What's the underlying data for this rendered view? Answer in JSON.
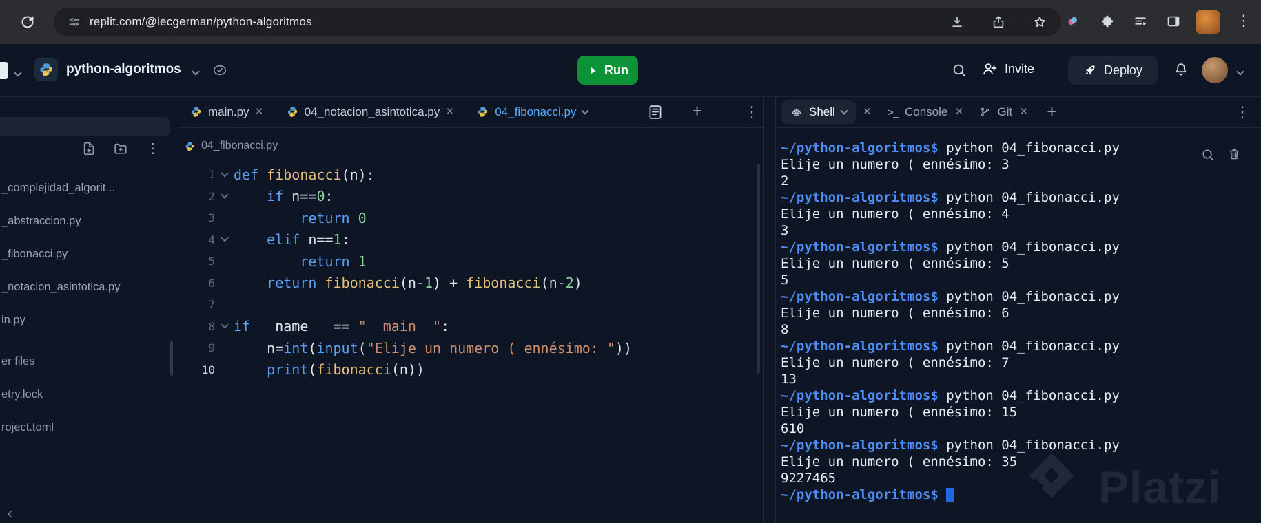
{
  "browser": {
    "url": "replit.com/@iecgerman/python-algoritmos"
  },
  "glyphs": {
    "kebab": "⋮",
    "plus": "+",
    "close": "×",
    "console_icon": ">_"
  },
  "colors": {
    "accent_blue": "#57abff",
    "run_green": "#0c9338",
    "prompt_blue": "#4c8df6",
    "keyword_blue": "#5ca0f2",
    "function_yellow": "#e6c07a",
    "string_orange": "#cf8e6d"
  },
  "header": {
    "project_name": "python-algoritmos",
    "run_label": "Run",
    "invite_label": "Invite",
    "deploy_label": "Deploy"
  },
  "sidebar": {
    "files_top": [
      "_complejidad_algorit...",
      "_abstraccion.py",
      "_fibonacci.py",
      "_notacion_asintotica.py",
      "in.py"
    ],
    "files_bottom": [
      "er files",
      "etry.lock",
      "roject.toml"
    ]
  },
  "editor": {
    "tabs": [
      {
        "label": "main.py"
      },
      {
        "label": "04_notacion_asintotica.py"
      },
      {
        "label": "04_fibonacci.py"
      }
    ],
    "breadcrumb": "04_fibonacci.py",
    "code": {
      "fold_lines": [
        1,
        2,
        4,
        8
      ],
      "lines": [
        [
          [
            "k",
            "def "
          ],
          [
            "f",
            "fibonacci"
          ],
          [
            "p",
            "(n):"
          ]
        ],
        [
          [
            "p",
            "    "
          ],
          [
            "k",
            "if"
          ],
          [
            "p",
            " n=="
          ],
          [
            "n",
            "0"
          ],
          [
            "p",
            ":"
          ]
        ],
        [
          [
            "p",
            "        "
          ],
          [
            "k",
            "return"
          ],
          [
            "p",
            " "
          ],
          [
            "n",
            "0"
          ]
        ],
        [
          [
            "p",
            "    "
          ],
          [
            "k",
            "elif"
          ],
          [
            "p",
            " n=="
          ],
          [
            "n",
            "1"
          ],
          [
            "p",
            ":"
          ]
        ],
        [
          [
            "p",
            "        "
          ],
          [
            "k",
            "return"
          ],
          [
            "p",
            " "
          ],
          [
            "n",
            "1"
          ]
        ],
        [
          [
            "p",
            "    "
          ],
          [
            "k",
            "return"
          ],
          [
            "p",
            " "
          ],
          [
            "f",
            "fibonacci"
          ],
          [
            "p",
            "(n-"
          ],
          [
            "n",
            "1"
          ],
          [
            "p",
            ") + "
          ],
          [
            "f",
            "fibonacci"
          ],
          [
            "p",
            "(n-"
          ],
          [
            "n",
            "2"
          ],
          [
            "p",
            ")"
          ]
        ],
        [],
        [
          [
            "k",
            "if"
          ],
          [
            "p",
            " __name__ == "
          ],
          [
            "s",
            "\"__main__\""
          ],
          [
            "p",
            ":"
          ]
        ],
        [
          [
            "p",
            "    n="
          ],
          [
            "b",
            "int"
          ],
          [
            "p",
            "("
          ],
          [
            "b",
            "input"
          ],
          [
            "p",
            "("
          ],
          [
            "s",
            "\"Elije un numero ( ennésimo: \""
          ],
          [
            "p",
            "))"
          ]
        ],
        [
          [
            "p",
            "    "
          ],
          [
            "b",
            "print"
          ],
          [
            "p",
            "("
          ],
          [
            "f",
            "fibonacci"
          ],
          [
            "p",
            "(n))"
          ]
        ]
      ]
    }
  },
  "terminal": {
    "tabs": [
      {
        "label": "Shell"
      },
      {
        "label": "Console"
      },
      {
        "label": "Git"
      }
    ],
    "prompt": "~/python-algoritmos$",
    "lines": [
      {
        "prompt": true,
        "text": " python 04_fibonacci.py"
      },
      {
        "text": "Elije un numero ( ennésimo: 3"
      },
      {
        "text": "2"
      },
      {
        "prompt": true,
        "text": " python 04_fibonacci.py"
      },
      {
        "text": "Elije un numero ( ennésimo: 4"
      },
      {
        "text": "3"
      },
      {
        "prompt": true,
        "text": " python 04_fibonacci.py"
      },
      {
        "text": "Elije un numero ( ennésimo: 5"
      },
      {
        "text": "5"
      },
      {
        "prompt": true,
        "text": " python 04_fibonacci.py"
      },
      {
        "text": "Elije un numero ( ennésimo: 6"
      },
      {
        "text": "8"
      },
      {
        "prompt": true,
        "text": " python 04_fibonacci.py"
      },
      {
        "text": "Elije un numero ( ennésimo: 7"
      },
      {
        "text": "13"
      },
      {
        "prompt": true,
        "text": " python 04_fibonacci.py"
      },
      {
        "text": "Elije un numero ( ennésimo: 15"
      },
      {
        "text": "610"
      },
      {
        "prompt": true,
        "text": " python 04_fibonacci.py"
      },
      {
        "text": "Elije un numero ( ennésimo: 35"
      },
      {
        "text": "9227465"
      },
      {
        "prompt": true,
        "text": " ",
        "cursor": true
      }
    ]
  },
  "watermark": {
    "text": "Platzi"
  }
}
